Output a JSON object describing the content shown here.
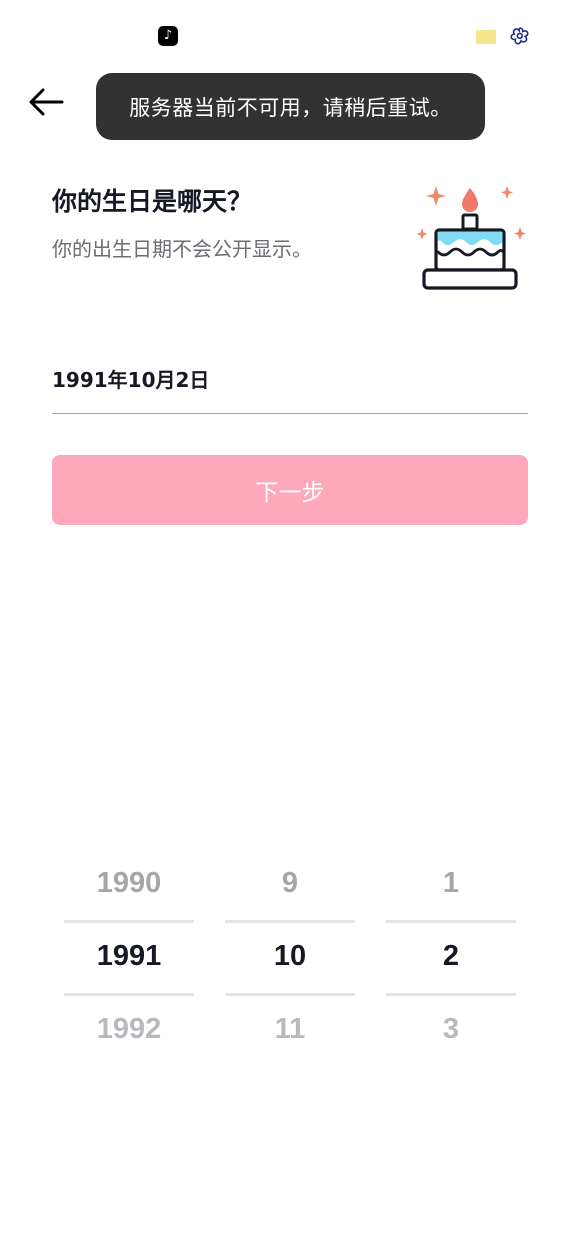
{
  "status_bar": {
    "app_icon": "tiktok-icon",
    "sim_icon": "sim-card-icon",
    "flower_icon": "flower-icon"
  },
  "header": {
    "back_icon": "arrow-left-icon"
  },
  "toast": {
    "message": "服务器当前不可用，请稍后重试。"
  },
  "page": {
    "title": "你的生日是哪天？",
    "subtitle": "你的出生日期不会公开显示。",
    "illustration": "birthday-cake-icon"
  },
  "date_field": {
    "value": "1991年10月2日"
  },
  "next_button": {
    "label": "下一步",
    "color": "#fea8bc"
  },
  "picker": {
    "year": {
      "prev": "1990",
      "current": "1991",
      "next": "1992"
    },
    "month": {
      "prev": "9",
      "current": "10",
      "next": "11"
    },
    "day": {
      "prev": "1",
      "current": "2",
      "next": "3"
    }
  }
}
